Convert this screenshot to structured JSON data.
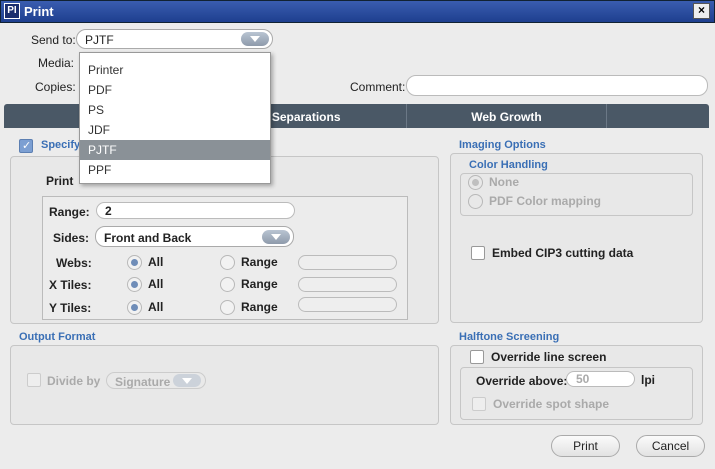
{
  "window": {
    "icon_text": "PI",
    "title": "Print",
    "close": "×"
  },
  "send_to": {
    "label": "Send to:",
    "value": "PJTF",
    "options": [
      "Printer",
      "PDF",
      "PS",
      "JDF",
      "PJTF",
      "PPF"
    ],
    "selected": "PJTF"
  },
  "media": {
    "label": "Media:"
  },
  "copies": {
    "label": "Copies:"
  },
  "comment": {
    "label": "Comment:",
    "value": ""
  },
  "tabs": [
    "or Separations",
    "Web Growth"
  ],
  "specify": {
    "label": "Specify",
    "checked": true
  },
  "print_label": "Print",
  "range": {
    "label": "Range:",
    "value": "2"
  },
  "sides": {
    "label": "Sides:",
    "value": "Front and Back"
  },
  "webs": {
    "label": "Webs:",
    "all": "All",
    "range": "Range"
  },
  "xtiles": {
    "label": "X Tiles:",
    "all": "All",
    "range": "Range"
  },
  "ytiles": {
    "label": "Y Tiles:",
    "all": "All",
    "range": "Range"
  },
  "output_format": {
    "title": "Output Format",
    "divide_by": "Divide by",
    "divide_value": "Signature"
  },
  "imaging": {
    "title": "Imaging Options",
    "color_handling": "Color Handling",
    "none": "None",
    "pdf_mapping": "PDF Color mapping",
    "embed": "Embed CIP3 cutting data"
  },
  "halftone": {
    "title": "Halftone Screening",
    "override_line": "Override line screen",
    "override_above": "Override above:",
    "above_value": "50",
    "unit": "lpi",
    "override_spot": "Override spot shape"
  },
  "buttons": {
    "print": "Print",
    "cancel": "Cancel"
  }
}
